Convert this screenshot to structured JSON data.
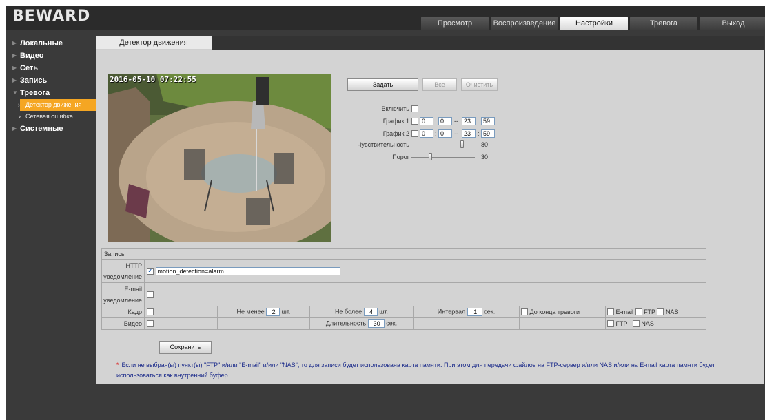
{
  "app": {
    "logo": "BEWARD"
  },
  "tabs": [
    "Просмотр",
    "Воспроизведение",
    "Настройки",
    "Тревога",
    "Выход"
  ],
  "active_tab_index": 2,
  "sidebar": {
    "items": [
      {
        "label": "Локальные"
      },
      {
        "label": "Видео"
      },
      {
        "label": "Сеть"
      },
      {
        "label": "Запись"
      },
      {
        "label": "Тревога"
      },
      {
        "label": "Системные"
      }
    ],
    "subitems": [
      {
        "label": "Детектор движения",
        "active": true
      },
      {
        "label": "Сетевая ошибка",
        "active": false
      }
    ]
  },
  "content": {
    "tab_label": "Детектор движения",
    "video_osd": "2016-05-10 07:22:55",
    "buttons": {
      "set": "Задать",
      "all": "Все",
      "clear": "Очистить"
    },
    "enable_label": "Включить",
    "schedule1": {
      "label": "График 1",
      "h1": "0",
      "m1": "0",
      "h2": "23",
      "m2": "59"
    },
    "schedule2": {
      "label": "График 2",
      "h1": "0",
      "m1": "0",
      "h2": "23",
      "m2": "59"
    },
    "sensitivity": {
      "label": "Чувствительность",
      "value": "80",
      "fraction": 0.8
    },
    "threshold": {
      "label": "Порог",
      "value": "30",
      "fraction": 0.3
    }
  },
  "record": {
    "header": "Запись",
    "http_label_1": "HTTP",
    "http_label_2": "уведомление",
    "http_value": "motion_detection=alarm",
    "http_checked": true,
    "email_label_1": "E-mail",
    "email_label_2": "уведомление",
    "frame_label": "Кадр",
    "min_label": "Не менее",
    "min_value": "2",
    "max_label": "Не более",
    "max_value": "4",
    "pcs": "шт.",
    "interval_label": "Интервал",
    "interval_value": "1",
    "sec": "сек.",
    "until_alarm_end": "До конца тревоги",
    "email_opt": "E-mail",
    "ftp_opt": "FTP",
    "nas_opt": "NAS",
    "video_label": "Видео",
    "duration_label": "Длительность",
    "duration_value": "30"
  },
  "save_button": "Сохранить",
  "note_star": "*",
  "note": "Если не выбран(ы) пункт(ы) \"FTP\" и/или \"E-mail\" и/или \"NAS\", то для записи будет использована карта памяти. При этом для передачи файлов на FTP-сервер и/или NAS и/или на E-mail карта памяти будет использоваться как внутренний буфер.",
  "colors": {
    "accent": "#f5a623",
    "panel": "#d3d3d3",
    "background": "#3a3a3a",
    "note_text": "#1a2a8a"
  }
}
